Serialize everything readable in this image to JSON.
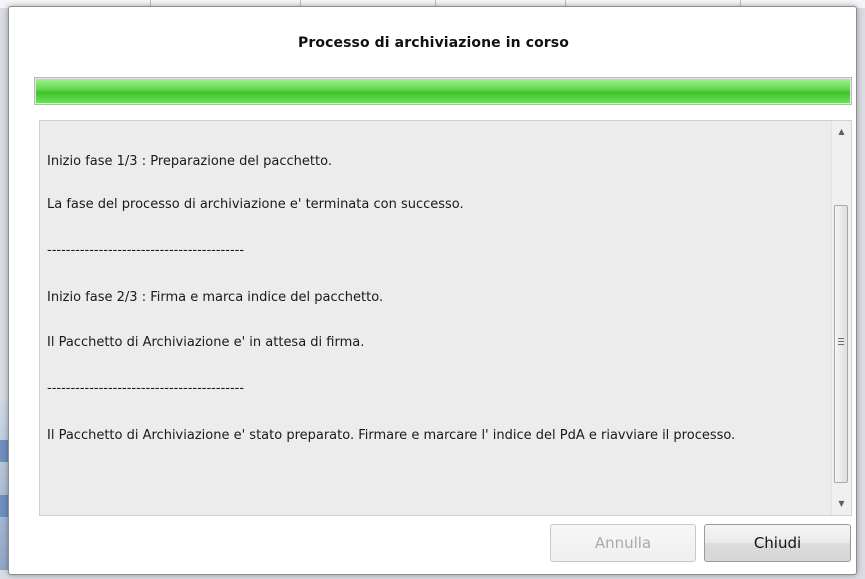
{
  "dialog": {
    "title": "Processo di archiviazione in corso",
    "progress_percent": 100,
    "progress_color": "#5fd64a"
  },
  "log": {
    "lines": [
      "Inizio fase 1/3 : Preparazione del pacchetto.",
      "La fase del processo di archiviazione e' terminata con successo.",
      "------------------------------------------",
      "Inizio fase 2/3 : Firma e marca indice del pacchetto.",
      "Il Pacchetto di Archiviazione e' in attesa di firma.",
      "------------------------------------------",
      "Il Pacchetto di Archiviazione e' stato preparato. Firmare e marcare l' indice del PdA e riavviare il processo."
    ]
  },
  "scrollbar": {
    "up_icon": "scroll-up-icon",
    "down_icon": "scroll-down-icon"
  },
  "buttons": {
    "cancel_label": "Annulla",
    "close_label": "Chiudi"
  }
}
